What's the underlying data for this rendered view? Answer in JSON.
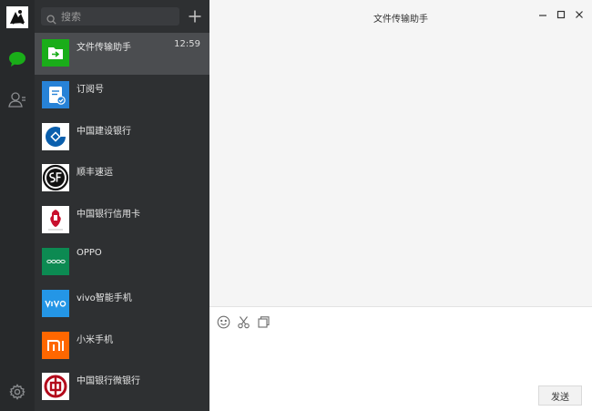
{
  "search": {
    "placeholder": "搜索"
  },
  "chat_list": [
    {
      "name": "文件传输助手",
      "time": "12:59",
      "icon": "file-transfer-icon",
      "color": "#1aad19"
    },
    {
      "name": "订阅号",
      "icon": "subscription-icon",
      "color": "#2782d7"
    },
    {
      "name": "中国建设银行",
      "icon": "ccb-logo",
      "color": "#0a5fad"
    },
    {
      "name": "顺丰速运",
      "icon": "sf-logo",
      "color": "#111111"
    },
    {
      "name": "中国银行信用卡",
      "icon": "boc-card-logo",
      "color": "#c8102e"
    },
    {
      "name": "OPPO",
      "icon": "oppo-logo",
      "color": "#0c8a52"
    },
    {
      "name": "vivo智能手机",
      "icon": "vivo-logo",
      "color": "#2496e6"
    },
    {
      "name": "小米手机",
      "icon": "mi-logo",
      "color": "#ff6700"
    },
    {
      "name": "中国银行微银行",
      "icon": "boc-logo",
      "color": "#b30a1c"
    }
  ],
  "chat": {
    "title": "文件传输助手"
  },
  "composer": {
    "send_label": "发送"
  },
  "colors": {
    "accent": "#1aad19",
    "rail_bg": "#27292b",
    "list_bg": "#2e3032",
    "list_active_bg": "#4b4d50"
  }
}
